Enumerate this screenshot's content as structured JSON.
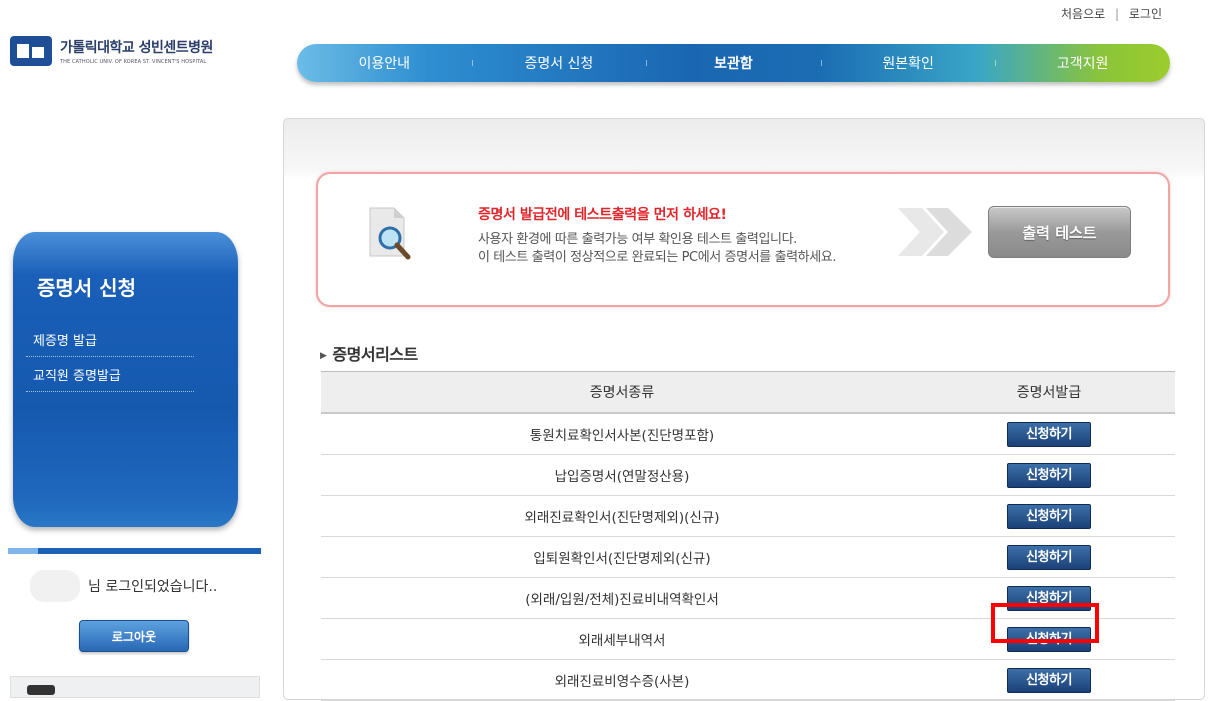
{
  "top_links": {
    "home": "처음으로",
    "separator": "|",
    "login": "로그인"
  },
  "logo": {
    "name_ko": "가톨릭대학교 성빈센트병원",
    "name_en": "THE CATHOLIC UNIV. OF KOREA ST. VINCENT'S HOSPITAL"
  },
  "nav": {
    "items": [
      {
        "label": "이용안내"
      },
      {
        "label": "증명서 신청"
      },
      {
        "label": "보관함"
      },
      {
        "label": "원본확인"
      },
      {
        "label": "고객지원"
      }
    ]
  },
  "sidebar": {
    "title": "증명서 신청",
    "menu": [
      {
        "label": "제증명 발급"
      },
      {
        "label": "교직원 증명발급"
      }
    ],
    "login_message": "님 로그인되었습니다..",
    "logout_label": "로그아웃"
  },
  "notice": {
    "title": "증명서 발급전에 테스트출력을 먼저 하세요!",
    "line1": "사용자 환경에 따른 출력가능 여부 확인용 테스트 출력입니다.",
    "line2": "이 테스트 출력이 정상적으로 완료되는 PC에서 증명서를 출력하세요.",
    "button": "출력 테스트"
  },
  "section": {
    "title": "증명서리스트"
  },
  "table": {
    "headers": [
      "증명서종류",
      "증명서발급"
    ],
    "button_label": "신청하기",
    "rows": [
      {
        "name": "통원치료확인서사본(진단명포함)"
      },
      {
        "name": "납입증명서(연말정산용)"
      },
      {
        "name": "외래진료확인서(진단명제외)(신규)"
      },
      {
        "name": "입퇴원확인서(진단명제외(신규)"
      },
      {
        "name": "(외래/입원/전체)진료비내역확인서"
      },
      {
        "name": "외래세부내역서"
      },
      {
        "name": "외래진료비영수증(사본)"
      }
    ]
  },
  "colors": {
    "accent_blue": "#1b5fb5",
    "notice_border": "#f2a4a4",
    "notice_title": "#e0262b",
    "highlight": "#ff0000"
  }
}
